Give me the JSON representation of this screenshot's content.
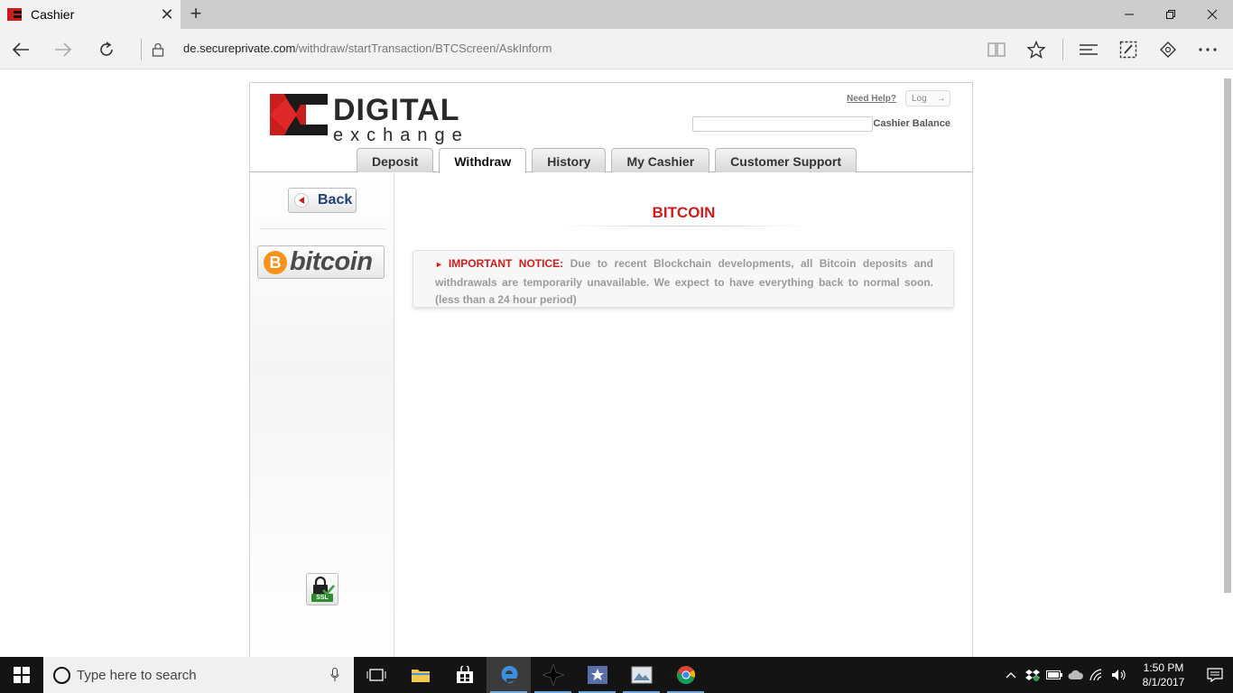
{
  "browser": {
    "tab_title": "Cashier",
    "url_host": "de.secureprivate.com",
    "url_path": "/withdraw/startTransaction/BTCScreen/AskInform"
  },
  "site": {
    "logo_line1": "DIGITAL",
    "logo_line2": "exchange",
    "help_link": "Need Help?",
    "logout_label": "Log",
    "balance_label": "Cashier Balance",
    "balance_value": "",
    "tabs": [
      {
        "label": "Deposit",
        "active": false
      },
      {
        "label": "Withdraw",
        "active": true
      },
      {
        "label": "History",
        "active": false
      },
      {
        "label": "My Cashier",
        "active": false
      },
      {
        "label": "Customer Support",
        "active": false
      }
    ],
    "sidebar": {
      "back_label": "Back",
      "bitcoin_coin": "B",
      "bitcoin_word": "bitcoin",
      "ssl_label": "SSL"
    },
    "content": {
      "title": "BITCOIN",
      "notice_label": "IMPORTANT NOTICE:",
      "notice_text": "Due to recent Blockchain developments, all Bitcoin deposits and withdrawals are temporarily unavailable. We expect to have everything back to normal soon. (less than a 24 hour period)"
    },
    "colors": {
      "brand_red": "#d01c1c",
      "nav_blue": "#1e3f7a",
      "bitcoin_orange": "#f7931a"
    }
  },
  "taskbar": {
    "search_placeholder": "Type here to search",
    "time": "1:50 PM",
    "date": "8/1/2017",
    "apps": [
      "task-view-icon",
      "file-explorer-icon",
      "store-icon",
      "edge-icon",
      "app-black-icon",
      "app-blue-icon",
      "app-gallery-icon",
      "chrome-icon"
    ]
  }
}
